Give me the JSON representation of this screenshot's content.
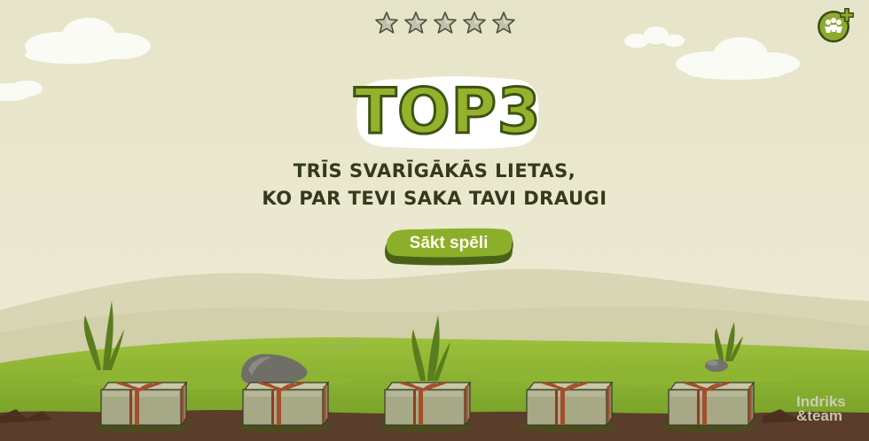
{
  "game": {
    "title": "TOP3",
    "tagline_line1": "TRĪS SVARĪGĀKĀS LIETAS,",
    "tagline_line2": "KO PAR TEVI SAKA TAVI DRAUGI",
    "start_label": "Sākt spēli",
    "watermark_line1": "Indriks",
    "watermark_line2": "&team"
  },
  "rating": {
    "max": 5,
    "filled": 0
  },
  "colors": {
    "sky": "#ebe8cf",
    "grass": "#84ad2e",
    "soil": "#5a3d2a",
    "accent_green": "#94b22c",
    "dark_green": "#4a6218",
    "star": "#c2c0ad"
  },
  "icons": {
    "friends_button": "add-friends-icon",
    "star": "star-icon",
    "box": "package-icon"
  },
  "packages": {
    "count": 5
  }
}
